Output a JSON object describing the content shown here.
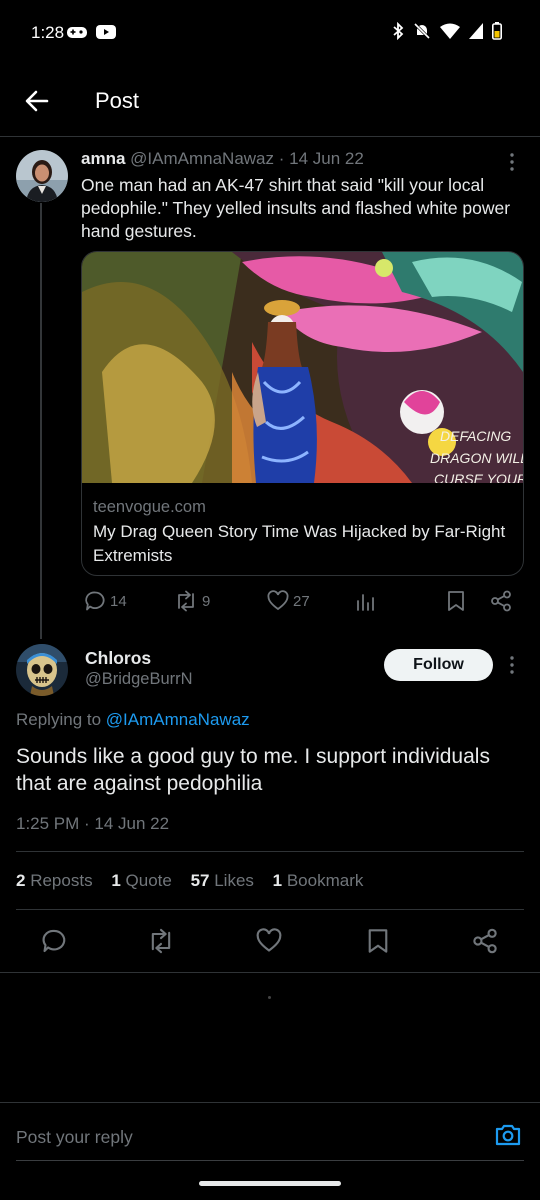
{
  "status_bar": {
    "time": "1:28"
  },
  "header": {
    "title": "Post"
  },
  "quoted_post": {
    "name": "amna",
    "handle": "@IAmAmnaNawaz",
    "date": "· 14 Jun 22",
    "text": "One man had an AK-47 shirt that said \"kill your local pedophile.\" They yelled insults and flashed white power hand gestures.",
    "card": {
      "image_text": "DEFACING\nDRAGON WILL\nCURSE YOUR",
      "domain": "teenvogue.com",
      "title": "My Drag Queen Story Time Was Hijacked by Far-Right Extremists"
    },
    "actions": {
      "replies": "14",
      "reposts": "9",
      "likes": "27"
    }
  },
  "main_post": {
    "name": "Chloros",
    "handle": "@BridgeBurrN",
    "follow_label": "Follow",
    "replying_prefix": "Replying to",
    "replying_handle": "@IAmAmnaNawaz",
    "text": "Sounds like a good guy to me.  I support  individuals that are against pedophilia",
    "timestamp": "1:25 PM · 14 Jun 22",
    "stats": {
      "reposts_count": "2",
      "reposts_label": "Reposts",
      "quotes_count": "1",
      "quotes_label": "Quote",
      "likes_count": "57",
      "likes_label": "Likes",
      "bookmarks_count": "1",
      "bookmarks_label": "Bookmark"
    }
  },
  "reply_box": {
    "placeholder": "Post your reply"
  },
  "colors": {
    "background": "#000000",
    "accent": "#1d9bf0",
    "muted": "#71767b",
    "text": "#e7e9ea"
  }
}
